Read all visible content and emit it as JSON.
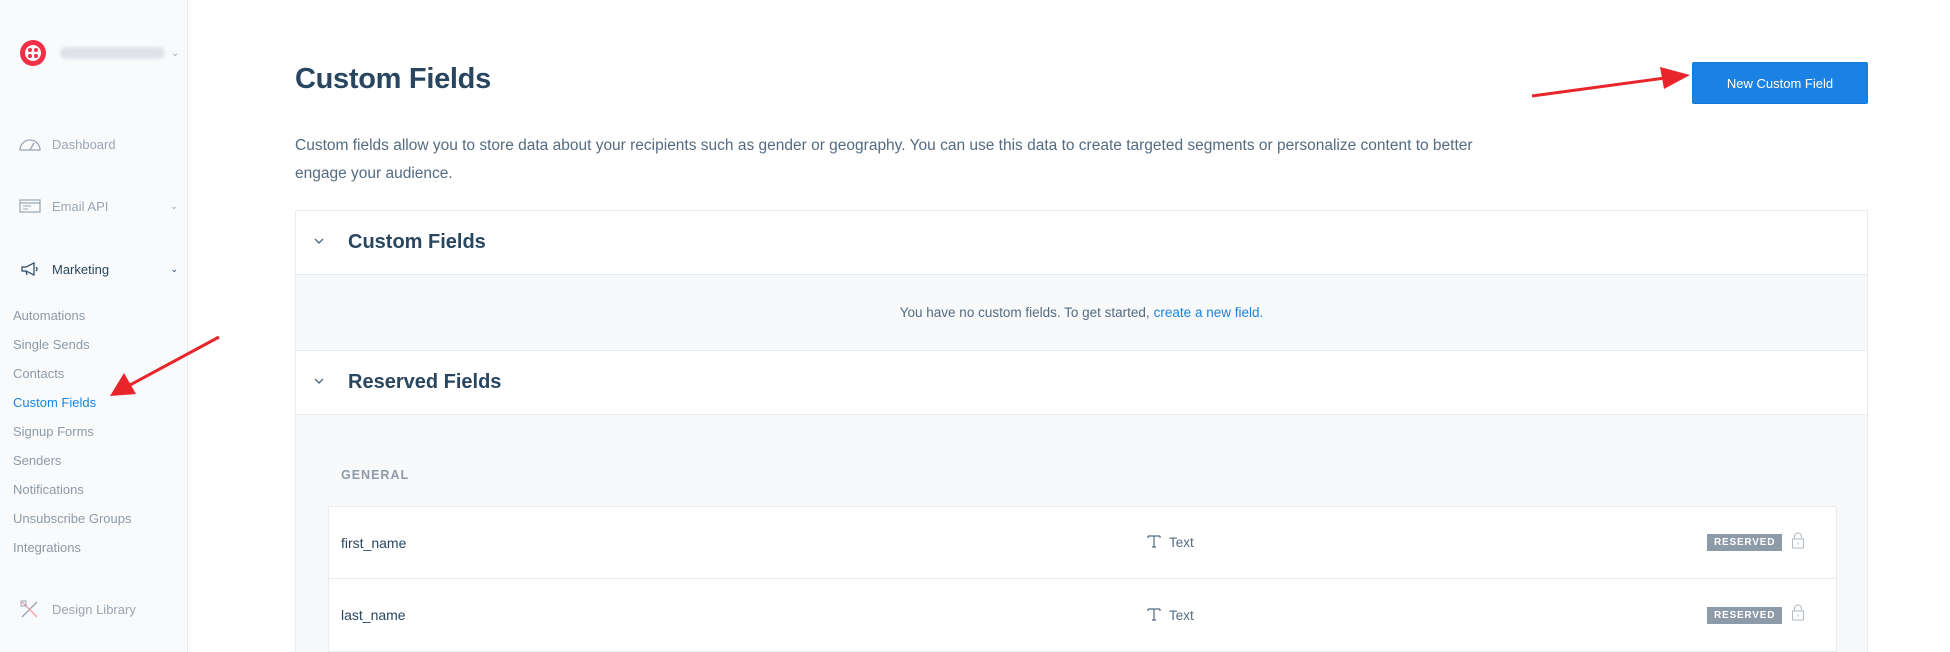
{
  "sidebar": {
    "account_chevron": "⌄",
    "nav": [
      {
        "label": "Dashboard",
        "icon": "gauge-icon"
      },
      {
        "label": "Email API",
        "icon": "email-window-icon",
        "chevron": "⌄"
      },
      {
        "label": "Marketing",
        "icon": "megaphone-icon",
        "chevron": "⌄"
      }
    ],
    "marketing_items": [
      {
        "label": "Automations"
      },
      {
        "label": "Single Sends"
      },
      {
        "label": "Contacts"
      },
      {
        "label": "Custom Fields",
        "active": true
      },
      {
        "label": "Signup Forms"
      },
      {
        "label": "Senders"
      },
      {
        "label": "Notifications"
      },
      {
        "label": "Unsubscribe Groups"
      },
      {
        "label": "Integrations"
      }
    ],
    "design_library": {
      "label": "Design Library",
      "icon": "design-tools-icon"
    }
  },
  "page": {
    "title": "Custom Fields",
    "new_button": "New Custom Field",
    "description": "Custom fields allow you to store data about your recipients such as gender or geography. You can use this data to create targeted segments or personalize content to better engage your audience."
  },
  "custom_section": {
    "title": "Custom Fields",
    "empty_text": "You have no custom fields. To get started,",
    "empty_link": "create a new field."
  },
  "reserved_section": {
    "title": "Reserved Fields",
    "group": "GENERAL",
    "rows": [
      {
        "name": "first_name",
        "type": "Text",
        "badge": "RESERVED"
      },
      {
        "name": "last_name",
        "type": "Text",
        "badge": "RESERVED"
      }
    ]
  },
  "colors": {
    "accent": "#1a82e2",
    "heading": "#294661",
    "annotation_arrow": "#e8252a",
    "logo": "#f22f46"
  }
}
